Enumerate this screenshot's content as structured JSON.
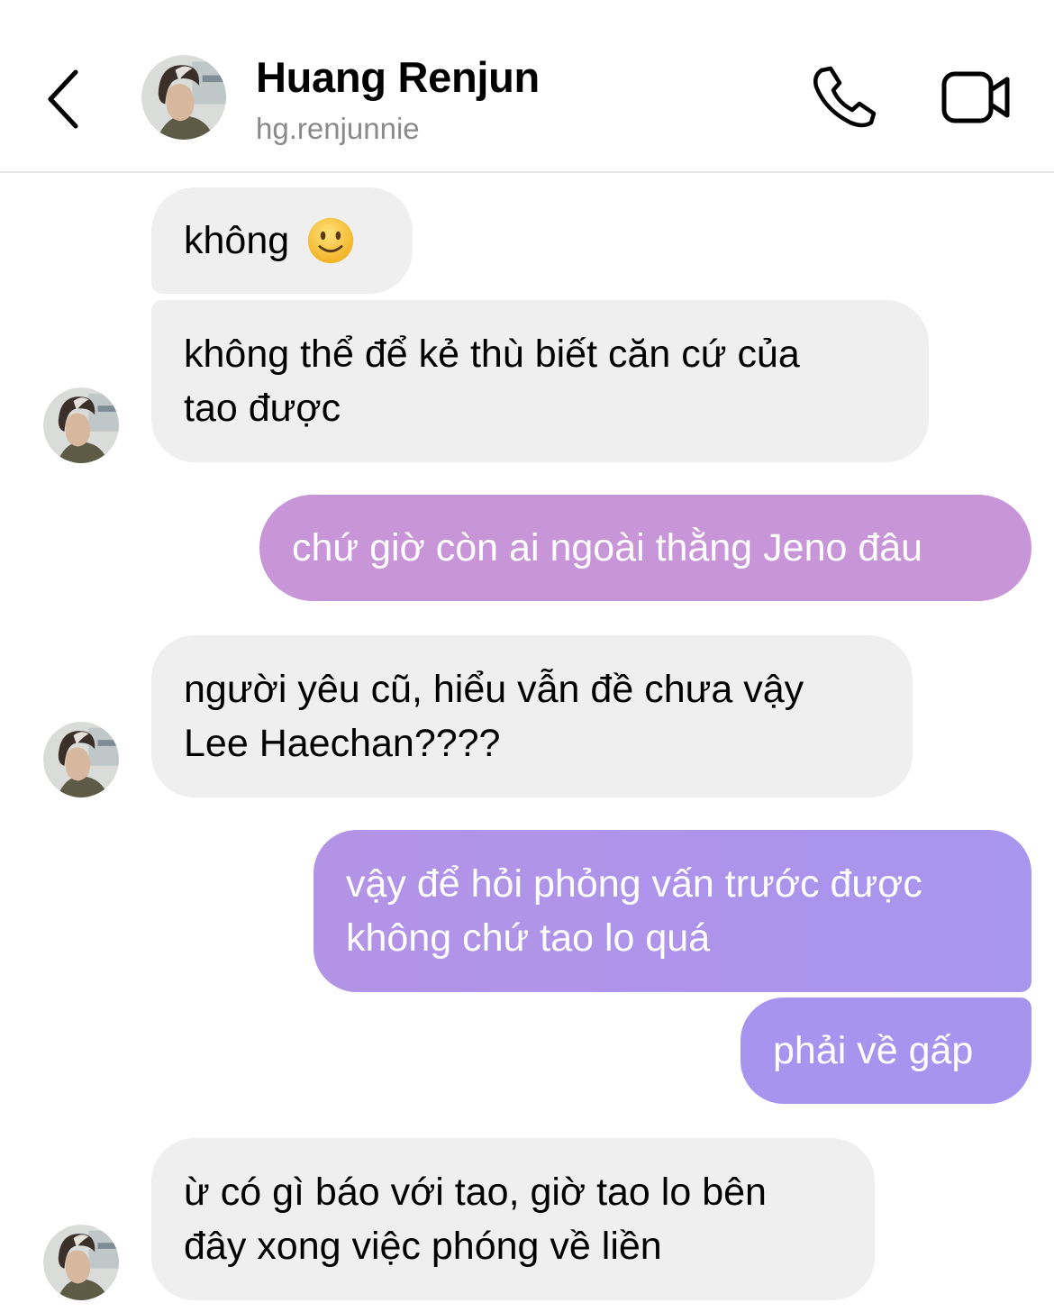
{
  "header": {
    "title": "Huang Renjun",
    "username": "hg.renjunnie",
    "back_icon": "chevron-left-icon",
    "call_icon": "phone-icon",
    "video_icon": "video-camera-icon"
  },
  "colors": {
    "incoming_bubble": "#efefef",
    "outgoing_gradient": [
      "#c795d8",
      "#a794ee"
    ],
    "subtitle": "#8a8a8a"
  },
  "messages": [
    {
      "from": "them",
      "lines": [
        "không"
      ],
      "emoji": "slightly-smiling-face"
    },
    {
      "from": "them",
      "lines": [
        "không thể để kẻ thù biết căn cứ của",
        "tao được"
      ]
    },
    {
      "from": "me",
      "lines": [
        "chứ giờ còn ai ngoài thằng Jeno đâu"
      ]
    },
    {
      "from": "them",
      "lines": [
        "người yêu cũ, hiểu vẫn đề chưa vậy",
        "Lee Haechan????"
      ]
    },
    {
      "from": "me",
      "lines": [
        "vậy để hỏi phỏng vấn trước được",
        "không chứ tao lo quá"
      ]
    },
    {
      "from": "me",
      "lines": [
        "phải về gấp"
      ]
    },
    {
      "from": "them",
      "lines": [
        "ừ có gì báo với tao, giờ tao lo bên",
        "đây xong việc phóng về liền"
      ]
    }
  ]
}
